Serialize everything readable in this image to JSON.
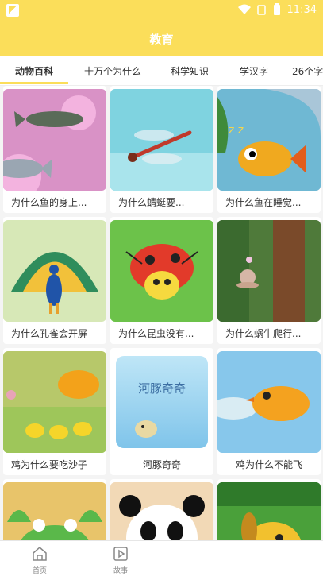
{
  "status_bar": {
    "time": "11:34",
    "icons": [
      "wifi-icon",
      "signal-icon",
      "battery-icon"
    ]
  },
  "app_bar": {
    "title": "教育"
  },
  "tabs": [
    {
      "label": "动物百科",
      "active": true
    },
    {
      "label": "十万个为什么",
      "active": false
    },
    {
      "label": "科学知识",
      "active": false
    },
    {
      "label": "学汉字",
      "active": false
    },
    {
      "label": "26个字",
      "active": false
    }
  ],
  "cards": [
    {
      "caption": "为什么鱼的身上..."
    },
    {
      "caption": "为什么蜻蜓要..."
    },
    {
      "caption": "为什么鱼在睡觉..."
    },
    {
      "caption": "为什么孔雀会开屏"
    },
    {
      "caption": "为什么昆虫没有..."
    },
    {
      "caption": "为什么蜗牛爬行..."
    },
    {
      "caption": "鸡为什么要吃沙子"
    },
    {
      "caption": "河豚奇奇"
    },
    {
      "caption": "鸡为什么不能飞"
    },
    {
      "caption": ""
    },
    {
      "caption": ""
    },
    {
      "caption": ""
    }
  ],
  "card_thumbs": {
    "card8_text": "河豚奇奇"
  },
  "bottom_nav": [
    {
      "label": "首页",
      "icon": "home-icon"
    },
    {
      "label": "故事",
      "icon": "video-icon"
    }
  ],
  "colors": {
    "brand_yellow": "#fbde5a"
  }
}
